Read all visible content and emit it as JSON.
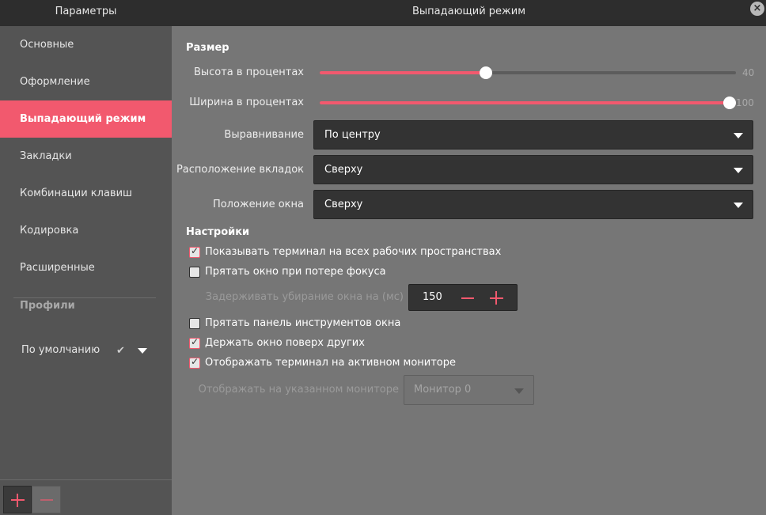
{
  "window": {
    "sidebar_title": "Параметры",
    "title": "Выпадающий режим",
    "close_label": "×"
  },
  "sidebar": {
    "items": [
      {
        "label": "Основные"
      },
      {
        "label": "Оформление"
      },
      {
        "label": "Выпадающий режим",
        "active": true
      },
      {
        "label": "Закладки"
      },
      {
        "label": "Комбинации клавиш"
      },
      {
        "label": "Кодировка"
      },
      {
        "label": "Расширенные"
      }
    ],
    "profiles_title": "Профили",
    "profile": {
      "name": "По умолчанию",
      "check": "✔"
    }
  },
  "size_section": {
    "title": "Размер",
    "height": {
      "label": "Высота в процентах",
      "value": 40,
      "max": 100,
      "display": "40"
    },
    "width": {
      "label": "Ширина в процентах",
      "value": 100,
      "max": 100,
      "display": "100"
    },
    "alignment": {
      "label": "Выравнивание",
      "value": "По центру"
    },
    "tabs_position": {
      "label": "Расположение вкладок",
      "value": "Сверху"
    },
    "window_position": {
      "label": "Положение окна",
      "value": "Сверху"
    }
  },
  "settings_section": {
    "title": "Настройки",
    "show_all_workspaces": {
      "label": "Показывать терминал на всех рабочих пространствах",
      "checked": true
    },
    "hide_on_focus_loss": {
      "label": "Прятать окно при потере фокуса",
      "checked": false
    },
    "hide_delay": {
      "label": "Задерживать убирание окна на (мс)",
      "value": "150"
    },
    "hide_toolbar": {
      "label": "Прятать панель инструментов окна",
      "checked": false
    },
    "keep_on_top": {
      "label": "Держать окно поверх других",
      "checked": true
    },
    "show_active_monitor": {
      "label": "Отображать терминал на активном мониторе",
      "checked": true
    },
    "monitor": {
      "label": "Отображать на указанном мониторе",
      "value": "Монитор 0"
    }
  },
  "colors": {
    "accent": "#f2596e",
    "sidebar": "#545454",
    "content": "#767676",
    "titlebar": "#2d2d2d"
  }
}
